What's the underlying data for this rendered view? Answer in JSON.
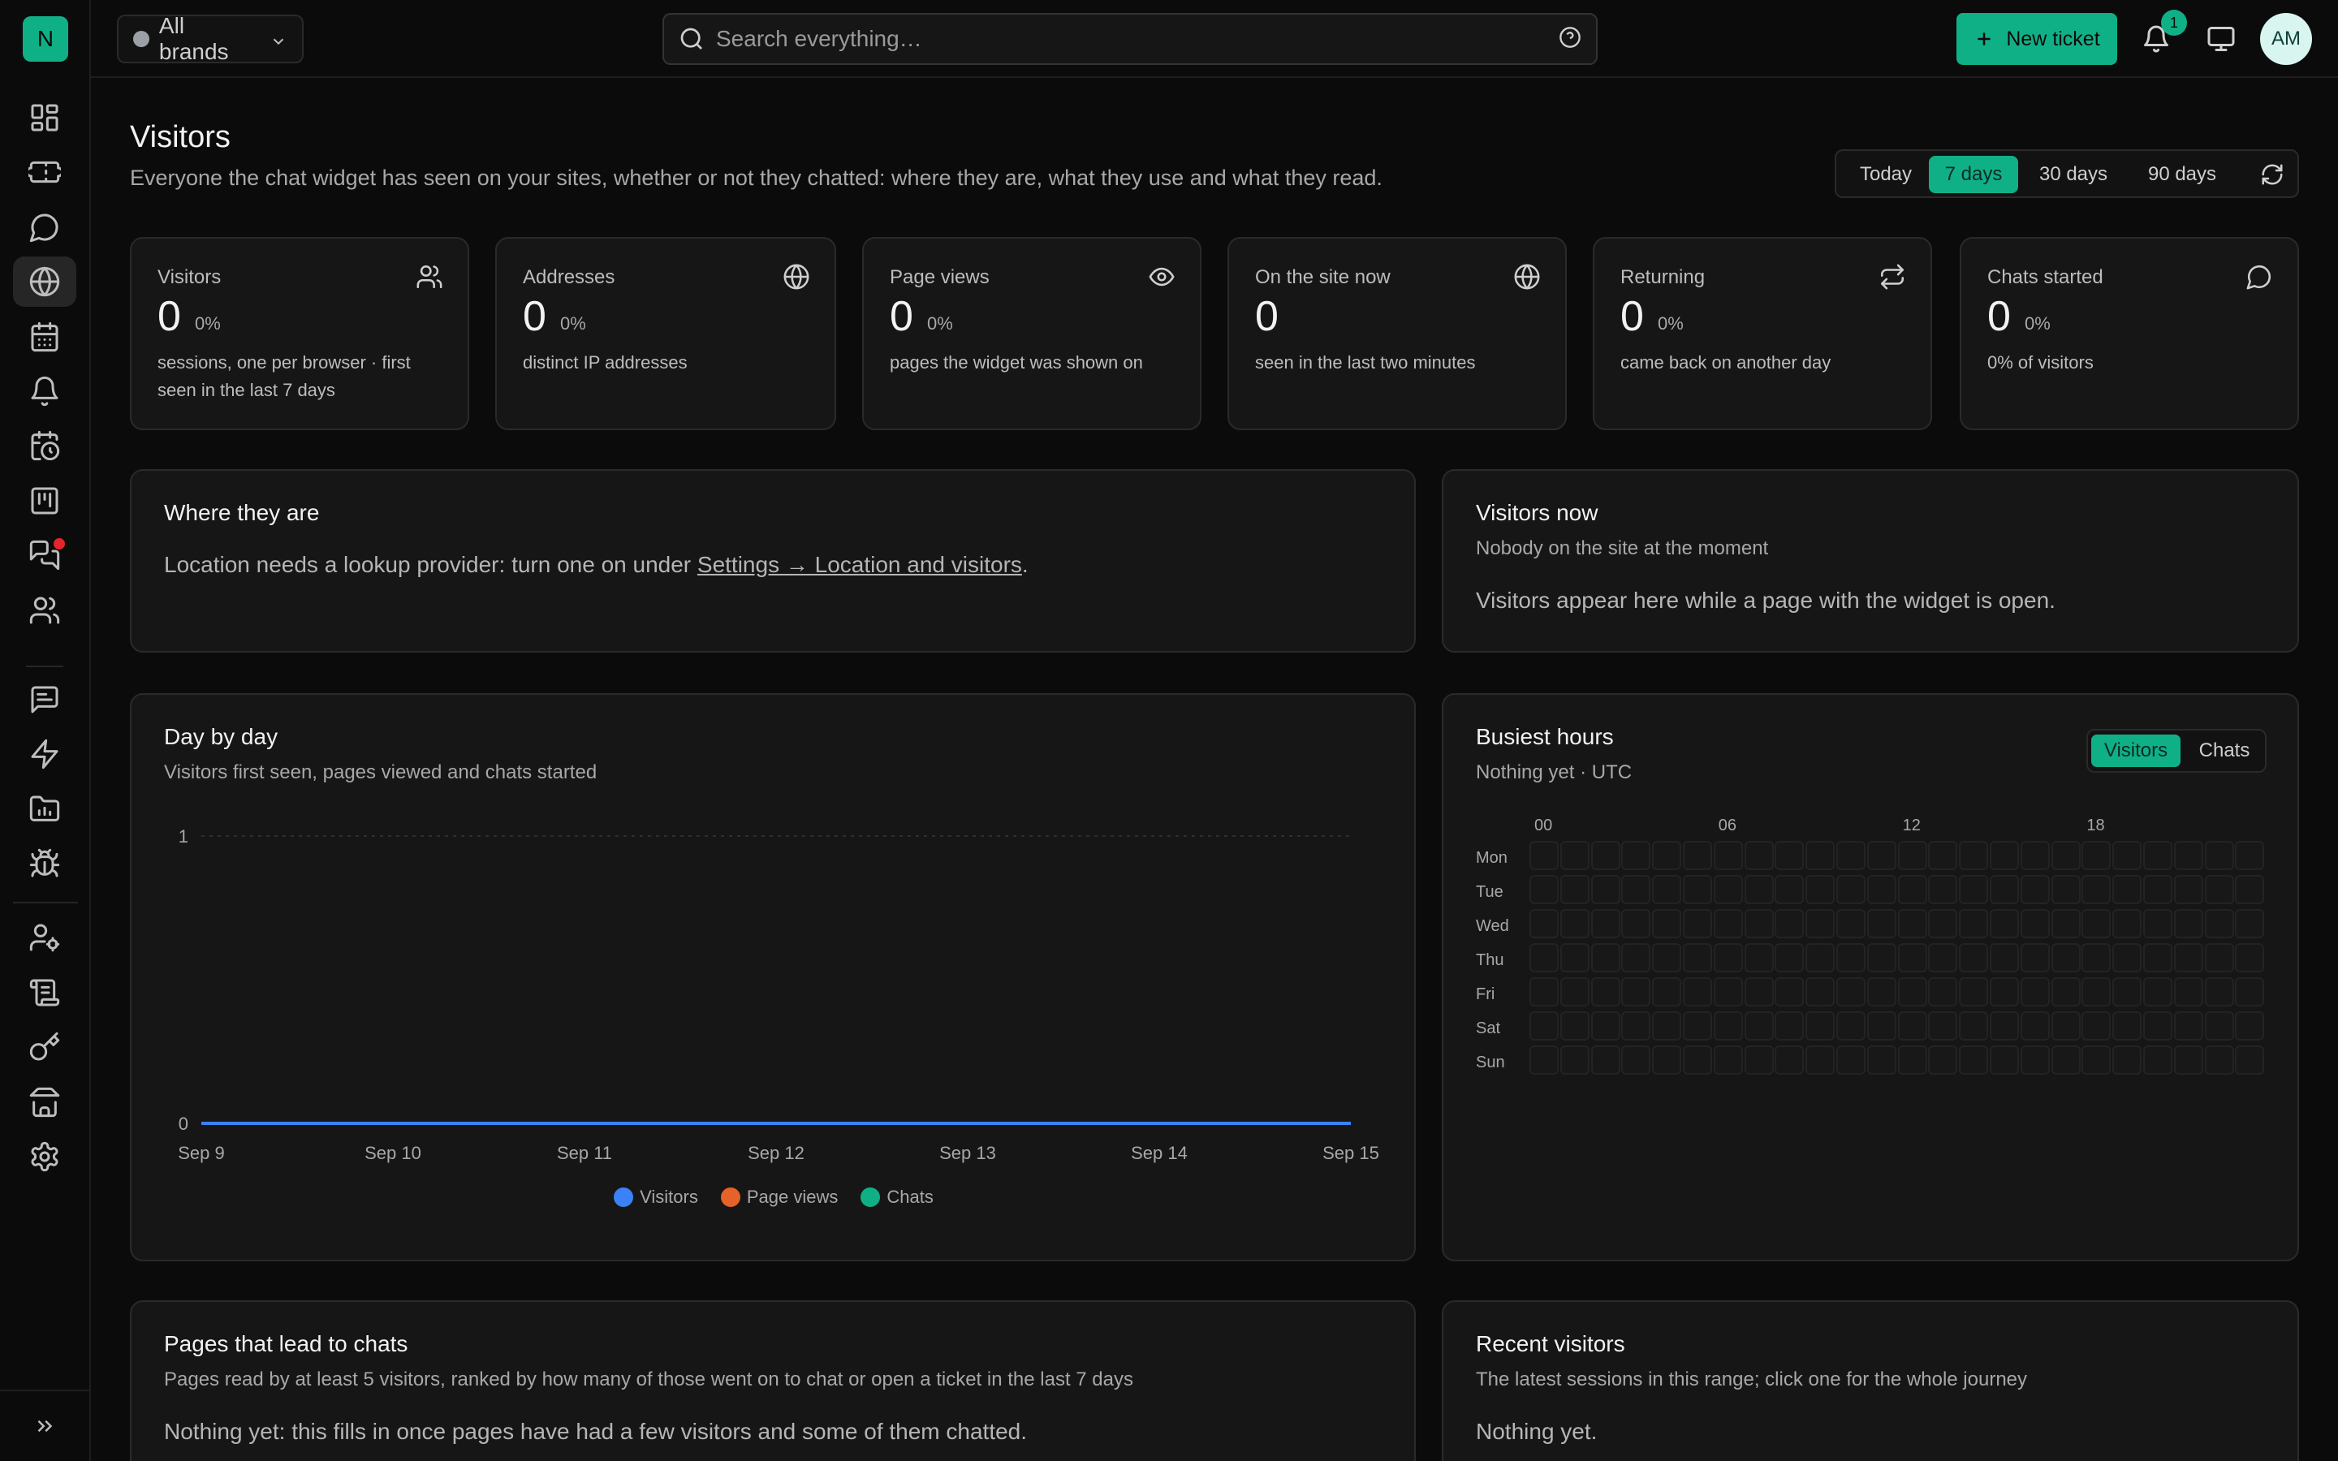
{
  "app": {
    "logo_letter": "N"
  },
  "colors": {
    "accent": "#10b086",
    "visitors": "#3b82f6",
    "page_views": "#e5622a",
    "chats": "#10b086",
    "alert": "#e5242b"
  },
  "sidebar": {
    "items": [
      {
        "icon": "dashboard-icon",
        "active": false
      },
      {
        "icon": "ticket-icon",
        "active": false
      },
      {
        "icon": "chat-bubble-icon",
        "active": false
      },
      {
        "icon": "globe-icon",
        "active": true
      },
      {
        "icon": "calendar-icon",
        "active": false
      },
      {
        "icon": "bell-icon",
        "active": false
      },
      {
        "icon": "calendar-clock-icon",
        "active": false
      },
      {
        "icon": "kanban-icon",
        "active": false
      },
      {
        "icon": "messages-icon",
        "active": false,
        "alert": true
      },
      {
        "icon": "users-icon",
        "active": false
      },
      {
        "icon": "message-square-text-icon",
        "active": false
      },
      {
        "icon": "bolt-icon",
        "active": false
      },
      {
        "icon": "folder-chart-icon",
        "active": false
      },
      {
        "icon": "bug-icon",
        "active": false
      },
      {
        "icon": "user-cog-icon",
        "active": false
      },
      {
        "icon": "scroll-icon",
        "active": false
      },
      {
        "icon": "key-icon",
        "active": false
      },
      {
        "icon": "store-icon",
        "active": false
      },
      {
        "icon": "settings-icon",
        "active": false
      }
    ]
  },
  "topbar": {
    "brand_select": "All brands",
    "search_placeholder": "Search everything…",
    "new_ticket": "New ticket",
    "notification_count": "1",
    "avatar_initials": "AM"
  },
  "header": {
    "title": "Visitors",
    "subtitle": "Everyone the chat widget has seen on your sites, whether or not they chatted: where they are, what they use and what they read.",
    "ranges": [
      "Today",
      "7 days",
      "30 days",
      "90 days"
    ],
    "active_range": "7 days"
  },
  "stats": [
    {
      "label": "Visitors",
      "value": "0",
      "pct": "0%",
      "desc": "sessions, one per browser · first seen in the last 7 days",
      "icon": "users-icon"
    },
    {
      "label": "Addresses",
      "value": "0",
      "pct": "0%",
      "desc": "distinct IP addresses",
      "icon": "globe-icon"
    },
    {
      "label": "Page views",
      "value": "0",
      "pct": "0%",
      "desc": "pages the widget was shown on",
      "icon": "eye-icon"
    },
    {
      "label": "On the site now",
      "value": "0",
      "pct": "",
      "desc": "seen in the last two minutes",
      "icon": "globe-icon"
    },
    {
      "label": "Returning",
      "value": "0",
      "pct": "0%",
      "desc": "came back on another day",
      "icon": "repeat-icon"
    },
    {
      "label": "Chats started",
      "value": "0",
      "pct": "0%",
      "desc": "0% of visitors",
      "icon": "chat-bubble-icon"
    }
  ],
  "where": {
    "title": "Where they are",
    "body_prefix": "Location needs a lookup provider: turn one on under ",
    "link": "Settings → Location and visitors",
    "body_suffix": "."
  },
  "visitors_now": {
    "title": "Visitors now",
    "subtitle": "Nobody on the site at the moment",
    "body": "Visitors appear here while a page with the widget is open."
  },
  "day_by_day": {
    "title": "Day by day",
    "subtitle": "Visitors first seen, pages viewed and chats started"
  },
  "chart_data": {
    "type": "line",
    "x": [
      "Sep 9",
      "Sep 10",
      "Sep 11",
      "Sep 12",
      "Sep 13",
      "Sep 14",
      "Sep 15"
    ],
    "series": [
      {
        "name": "Visitors",
        "values": [
          0,
          0,
          0,
          0,
          0,
          0,
          0
        ]
      },
      {
        "name": "Page views",
        "values": [
          0,
          0,
          0,
          0,
          0,
          0,
          0
        ]
      },
      {
        "name": "Chats",
        "values": [
          0,
          0,
          0,
          0,
          0,
          0,
          0
        ]
      }
    ],
    "yticks": [
      "0",
      "1"
    ],
    "ylim": [
      0,
      1
    ],
    "grid": true,
    "legend": "bottom-center"
  },
  "busiest": {
    "title": "Busiest hours",
    "subtitle": "Nothing yet · UTC",
    "toggle": [
      "Visitors",
      "Chats"
    ],
    "active_toggle": "Visitors",
    "columns": [
      "00",
      "06",
      "12",
      "18"
    ],
    "rows": [
      "Mon",
      "Tue",
      "Wed",
      "Thu",
      "Fri",
      "Sat",
      "Sun"
    ],
    "hours": 24
  },
  "pages": {
    "title": "Pages that lead to chats",
    "subtitle": "Pages read by at least 5 visitors, ranked by how many of those went on to chat or open a ticket in the last 7 days",
    "body": "Nothing yet: this fills in once pages have had a few visitors and some of them chatted."
  },
  "recent": {
    "title": "Recent visitors",
    "subtitle": "The latest sessions in this range; click one for the whole journey",
    "body": "Nothing yet."
  }
}
